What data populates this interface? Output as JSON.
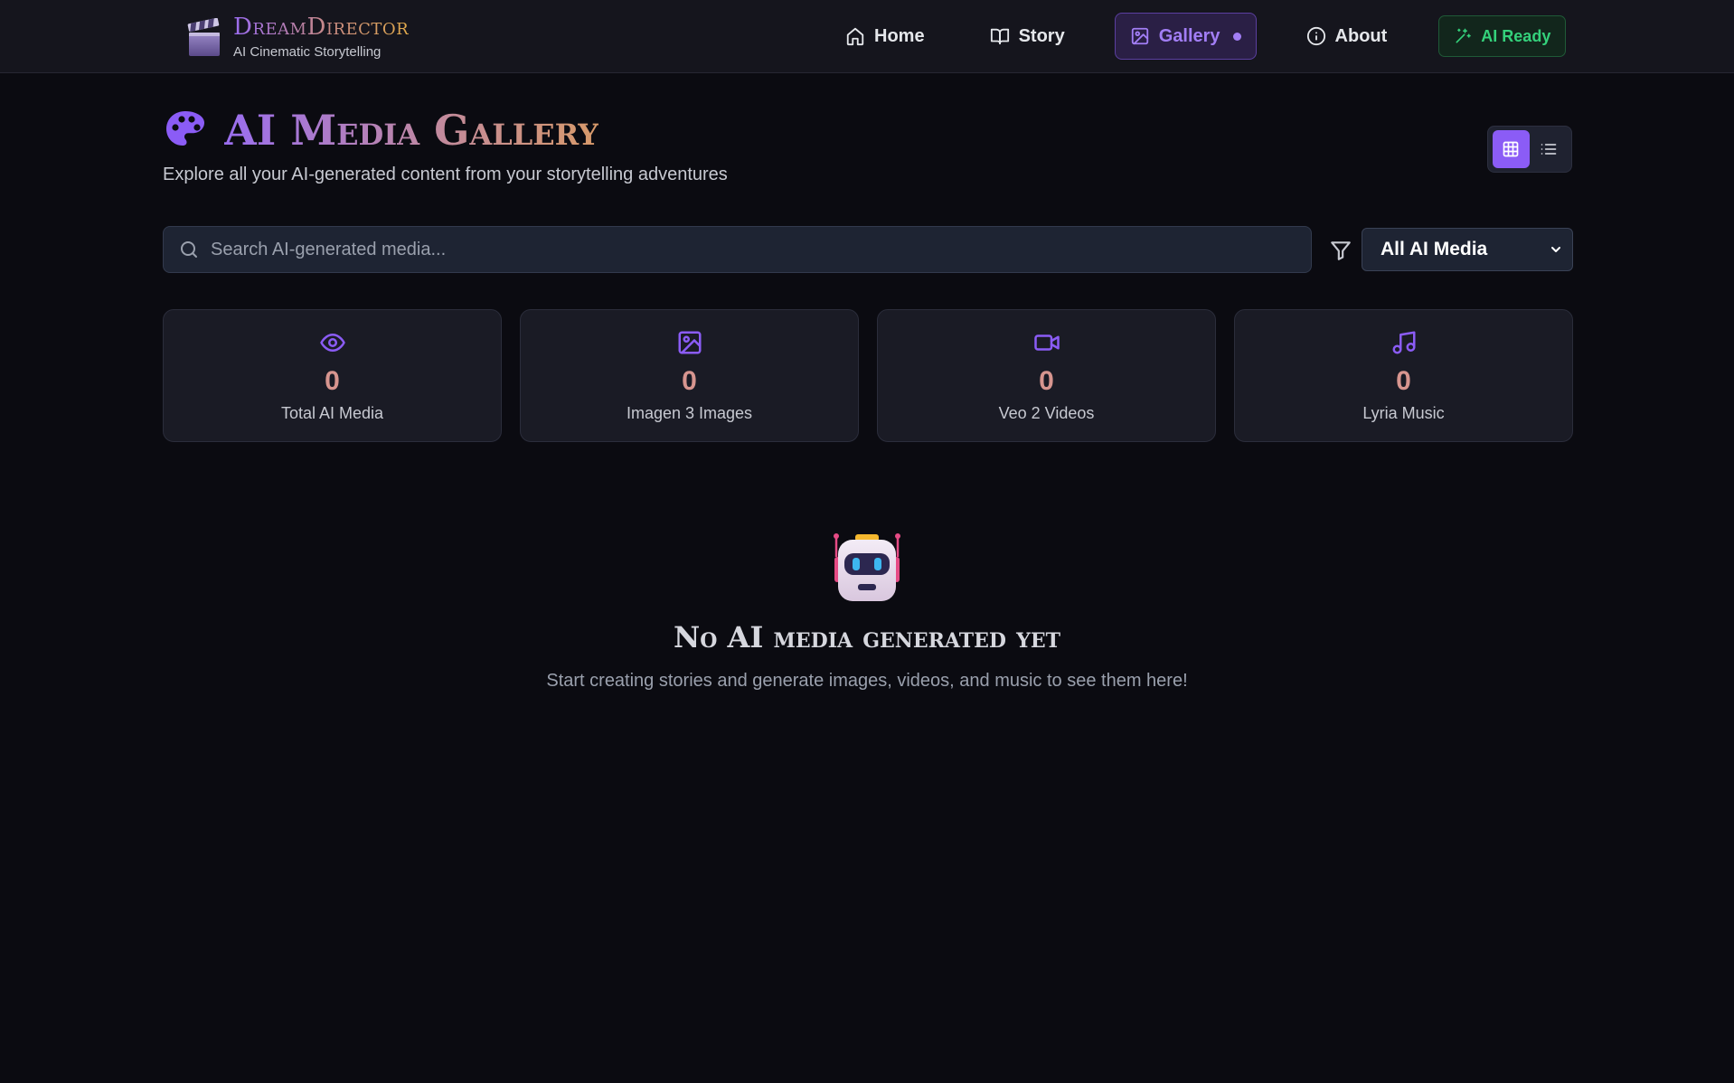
{
  "brand": {
    "title": "DreamDirector",
    "subtitle": "AI Cinematic Storytelling",
    "logo_icon": "clapperboard-icon"
  },
  "nav": {
    "items": [
      {
        "label": "Home",
        "icon": "home-icon"
      },
      {
        "label": "Story",
        "icon": "book-icon"
      },
      {
        "label": "Gallery",
        "icon": "image-icon",
        "active": true
      },
      {
        "label": "About",
        "icon": "info-icon"
      }
    ],
    "status_label": "AI Ready",
    "status_icon": "sparkles-icon"
  },
  "header": {
    "title": "AI Media Gallery",
    "subtitle": "Explore all your AI-generated content from your storytelling adventures",
    "icon": "palette-icon"
  },
  "view_toggle": {
    "active": "grid",
    "icons": [
      "grid-icon",
      "list-icon"
    ]
  },
  "search": {
    "placeholder": "Search AI-generated media...",
    "value": ""
  },
  "filter": {
    "selected": "All AI Media",
    "icon": "filter-icon"
  },
  "stats": [
    {
      "value": "0",
      "label": "Total AI Media",
      "icon": "eye-icon"
    },
    {
      "value": "0",
      "label": "Imagen 3 Images",
      "icon": "image-icon"
    },
    {
      "value": "0",
      "label": "Veo 2 Videos",
      "icon": "video-icon"
    },
    {
      "value": "0",
      "label": "Lyria Music",
      "icon": "music-icon"
    }
  ],
  "empty_state": {
    "title": "No AI media generated yet",
    "text": "Start creating stories and generate images, videos, and music to see them here!",
    "icon": "robot-icon"
  },
  "colors": {
    "accent": "#8b5cf6",
    "success": "#34d17b",
    "background": "#0b0b11",
    "stat_value": "#d7958f"
  }
}
